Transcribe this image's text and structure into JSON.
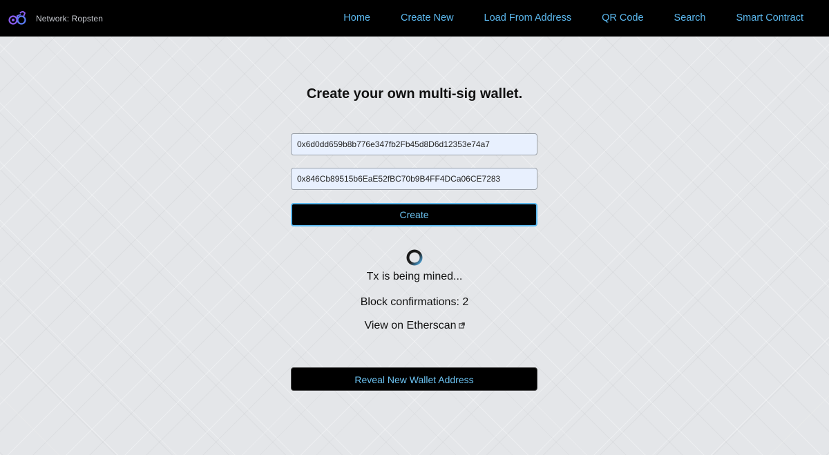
{
  "navbar": {
    "network_label": "Network: Ropsten",
    "links": [
      {
        "label": "Home"
      },
      {
        "label": "Create New"
      },
      {
        "label": "Load From Address"
      },
      {
        "label": "QR Code"
      },
      {
        "label": "Search"
      },
      {
        "label": "Smart Contract"
      }
    ],
    "logo_icon": "wallet-logo-icon"
  },
  "form": {
    "title": "Create your own multi-sig wallet.",
    "address_1": "0x6d0dd659b8b776e347fb2Fb45d8D6d12353e74a7",
    "address_2": "0x846Cb89515b6EaE52fBC70b9B4FF4DCa06CE7283",
    "create_label": "Create"
  },
  "status": {
    "mining_text": "Tx is being mined...",
    "confirmations_text": "Block confirmations: 2",
    "etherscan_label": "View on Etherscan",
    "external_icon": "external-link-icon",
    "spinner_icon": "loading-spinner-icon"
  },
  "reveal": {
    "label": "Reveal New Wallet Address"
  },
  "colors": {
    "navbar_bg": "#000000",
    "link_color": "#5bb8ee",
    "button_bg": "#000000",
    "input_bg": "#e8f0fe"
  }
}
